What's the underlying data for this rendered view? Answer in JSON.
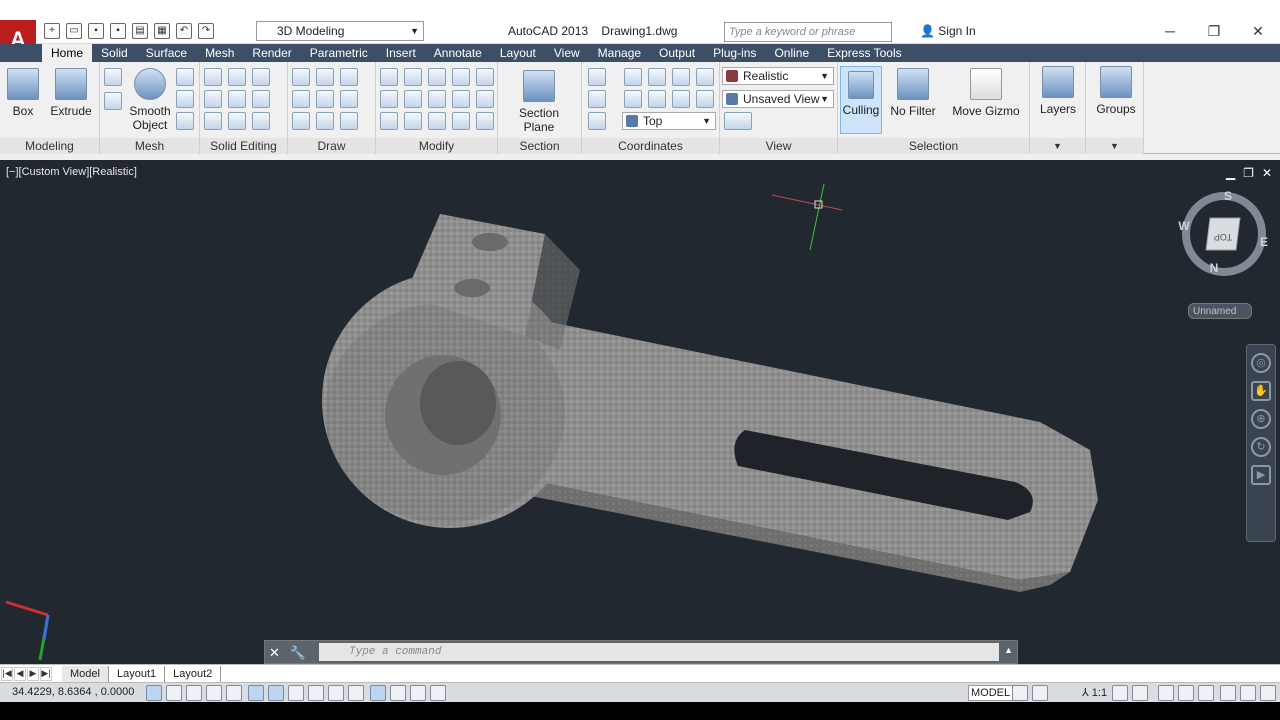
{
  "titlebar": {
    "app_title": "AutoCAD 2013",
    "document": "Drawing1.dwg",
    "workspace": "3D Modeling",
    "search_placeholder": "Type a keyword or phrase",
    "signin": "Sign In",
    "app_logo": "A"
  },
  "tabs": [
    "Home",
    "Solid",
    "Surface",
    "Mesh",
    "Render",
    "Parametric",
    "Insert",
    "Annotate",
    "Layout",
    "View",
    "Manage",
    "Output",
    "Plug-ins",
    "Online",
    "Express Tools"
  ],
  "ribbon": {
    "modeling": {
      "label": "Modeling",
      "box": "Box",
      "extrude": "Extrude"
    },
    "mesh": {
      "label": "Mesh",
      "smooth_object_1": "Smooth",
      "smooth_object_2": "Object"
    },
    "solid_editing": {
      "label": "Solid Editing"
    },
    "draw": {
      "label": "Draw"
    },
    "modify": {
      "label": "Modify"
    },
    "section": {
      "label": "Section",
      "plane_1": "Section",
      "plane_2": "Plane"
    },
    "coordinates": {
      "label": "Coordinates"
    },
    "view": {
      "label": "View",
      "visual_style": "Realistic",
      "saved_view": "Unsaved View",
      "named_view": "Top"
    },
    "selection": {
      "label": "Selection",
      "culling": "Culling",
      "no_filter": "No Filter",
      "move_gizmo": "Move Gizmo"
    },
    "layers": {
      "label": "Layers"
    },
    "groups": {
      "label": "Groups"
    }
  },
  "viewport": {
    "label": "[−][Custom View][Realistic]",
    "viewcube": {
      "north": "N",
      "south": "S",
      "east": "E",
      "west": "W",
      "face": "TOP"
    },
    "ucs_name": "Unnamed"
  },
  "command": {
    "placeholder": "Type a command"
  },
  "layout_tabs": [
    "Model",
    "Layout1",
    "Layout2"
  ],
  "status": {
    "coords": "34.4229, 8.6364 , 0.0000",
    "model": "MODEL",
    "scale": "1:1"
  },
  "colors": {
    "tab_bar": "#3d4f66",
    "viewport_bg": "#212830",
    "accent": "#b91d1d"
  }
}
